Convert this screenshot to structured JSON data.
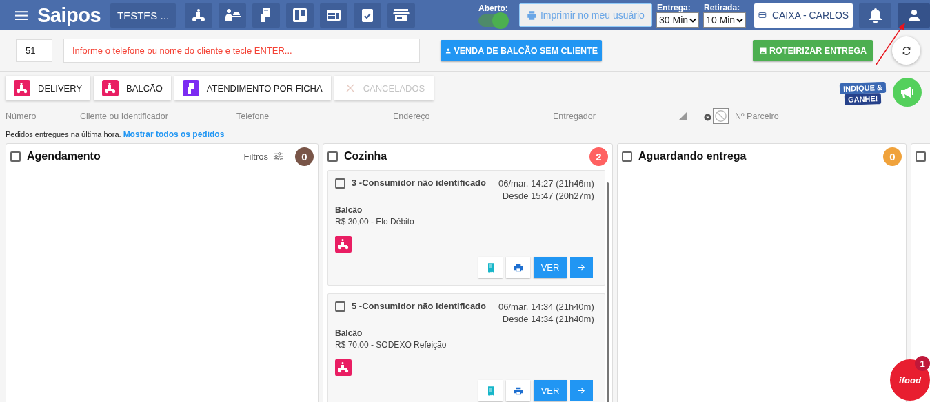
{
  "header": {
    "logo": "Saipos",
    "store": "TESTES ...",
    "open_label": "Aberto:",
    "open": true,
    "print_button": "Imprimir no meu usuário",
    "print_disabled": true,
    "delivery": {
      "label": "Entrega:",
      "value": "30 Min"
    },
    "pickup": {
      "label": "Retirada:",
      "value": "10 Min"
    },
    "cashier": "CAIXA - CARLOS"
  },
  "toolbar": {
    "order_number": "51",
    "customer_placeholder": "Informe o telefone ou nome do cliente e tecle ENTER...",
    "counter_sale": "VENDA DE BALCÃO SEM CLIENTE",
    "route": "ROTEIRIZAR ENTREGA"
  },
  "promo": {
    "line_1": "INDIQUE &",
    "line_2": "GANHE!"
  },
  "tabs": [
    {
      "label": "DELIVERY",
      "kind": "scooter",
      "disabled": false
    },
    {
      "label": "BALCÃO",
      "kind": "scooter",
      "disabled": false
    },
    {
      "label": "ATENDIMENTO POR FICHA",
      "kind": "ticket",
      "disabled": false
    },
    {
      "label": "CANCELADOS",
      "kind": "close",
      "disabled": true
    }
  ],
  "filters": [
    {
      "placeholder": "Número",
      "kind": "text"
    },
    {
      "placeholder": "Cliente ou Identificador",
      "kind": "text"
    },
    {
      "placeholder": "Telefone",
      "kind": "text"
    },
    {
      "placeholder": "Endereço",
      "kind": "text"
    },
    {
      "placeholder": "Entregador",
      "kind": "select"
    }
  ],
  "partner": {
    "placeholder": "Nº Parceiro"
  },
  "note": {
    "text": "Pedidos entregues na última hora.",
    "link": "Mostrar todos os pedidos"
  },
  "columns": [
    {
      "title": "Agendamento",
      "checked": false,
      "count": "0",
      "color": "#795548",
      "filters": "Filtros"
    },
    {
      "title": "Cozinha",
      "checked": false,
      "count": "2",
      "color": "#ff6161",
      "orders": [
        {
          "title": "3 -Consumidor não identificado",
          "checked": false,
          "time": "06/mar, 14:27 (21h46m)",
          "since": "Desde 15:47 (20h27m)",
          "type": "Balcão",
          "payment": "R$ 30,00 - Elo Débito",
          "view": "VER"
        },
        {
          "title": "5 -Consumidor não identificado",
          "checked": false,
          "time": "06/mar, 14:34 (21h40m)",
          "since": "Desde 14:34 (21h40m)",
          "type": "Balcão",
          "payment": "R$ 70,00 - SODEXO Refeição",
          "view": "VER"
        }
      ]
    },
    {
      "title": "Aguardando entrega",
      "checked": false,
      "count": "0",
      "color": "#f0a23b"
    },
    {
      "checked": false
    }
  ],
  "ifood": {
    "label": "ifood",
    "badge": "1"
  }
}
